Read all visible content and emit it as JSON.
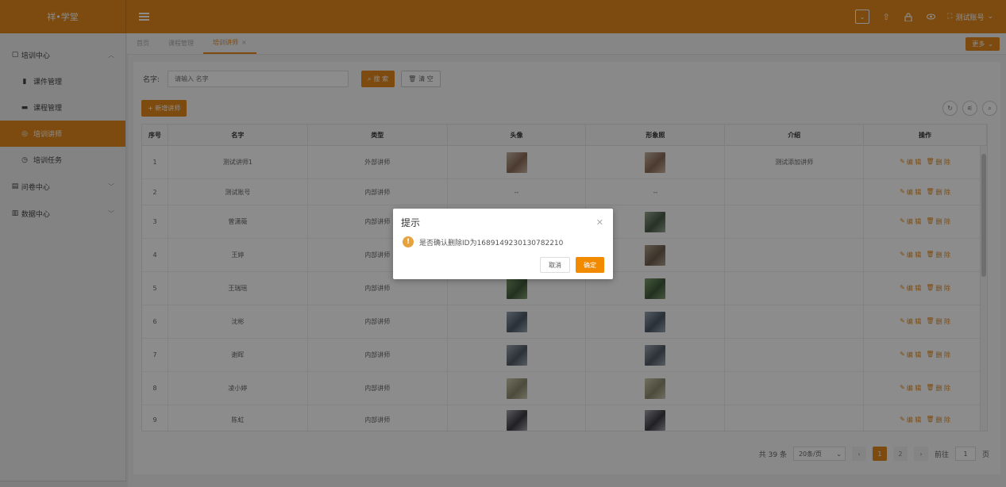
{
  "app": {
    "logo": "祥•学堂",
    "user": "测试账号"
  },
  "colors": {
    "accent": "#e4891c",
    "warning": "#e6a23c"
  },
  "sidebar": {
    "groups": [
      {
        "label": "培训中心",
        "icon": "doc-icon",
        "expanded": true
      },
      {
        "label": "问卷中心",
        "icon": "survey-icon",
        "expanded": false
      },
      {
        "label": "数据中心",
        "icon": "chart-icon",
        "expanded": false
      }
    ],
    "items": [
      {
        "label": "课件管理",
        "icon": "file-icon"
      },
      {
        "label": "课程管理",
        "icon": "book-icon"
      },
      {
        "label": "培训讲师",
        "icon": "user-icon",
        "active": true
      },
      {
        "label": "培训任务",
        "icon": "clock-icon"
      }
    ]
  },
  "tabs": [
    {
      "label": "首页"
    },
    {
      "label": "课程管理"
    },
    {
      "label": "培训讲师",
      "active": true,
      "close": "×"
    }
  ],
  "more_label": "更多",
  "search": {
    "label": "名字:",
    "placeholder": "请输入 名字",
    "search_btn": "搜 索",
    "clear_btn": "清 空"
  },
  "add_btn": "+ 新增讲师",
  "table": {
    "headers": [
      "序号",
      "名字",
      "类型",
      "头像",
      "形象照",
      "介绍",
      "操作"
    ],
    "edit_label": "编 辑",
    "delete_label": "删 除",
    "rows": [
      {
        "idx": "1",
        "name": "测试讲师1",
        "type": "外部讲师",
        "avatar": "photo",
        "portrait": "photo",
        "intro": "测试添加讲师"
      },
      {
        "idx": "2",
        "name": "测试账号",
        "type": "内部讲师",
        "avatar": "--",
        "portrait": "--",
        "intro": ""
      },
      {
        "idx": "3",
        "name": "曾潇薇",
        "type": "内部讲师",
        "avatar": "photo",
        "portrait": "photo",
        "intro": ""
      },
      {
        "idx": "4",
        "name": "王婷",
        "type": "内部讲师",
        "avatar": "photo",
        "portrait": "photo",
        "intro": ""
      },
      {
        "idx": "5",
        "name": "王瑞瑶",
        "type": "内部讲师",
        "avatar": "photo",
        "portrait": "photo",
        "intro": ""
      },
      {
        "idx": "6",
        "name": "沈彬",
        "type": "内部讲师",
        "avatar": "photo",
        "portrait": "photo",
        "intro": ""
      },
      {
        "idx": "7",
        "name": "谢晖",
        "type": "内部讲师",
        "avatar": "photo",
        "portrait": "photo",
        "intro": ""
      },
      {
        "idx": "8",
        "name": "凌小婷",
        "type": "内部讲师",
        "avatar": "photo",
        "portrait": "photo",
        "intro": ""
      },
      {
        "idx": "9",
        "name": "陈虹",
        "type": "内部讲师",
        "avatar": "photo",
        "portrait": "photo",
        "intro": ""
      }
    ]
  },
  "pagination": {
    "total": "共 39 条",
    "page_size": "20条/页",
    "pages": [
      "1",
      "2"
    ],
    "current": "1",
    "goto_label": "前往",
    "goto_value": "1",
    "page_suffix": "页"
  },
  "dialog": {
    "title": "提示",
    "message": "是否确认删除ID为1689149230130782210",
    "cancel": "取消",
    "confirm": "确定"
  }
}
